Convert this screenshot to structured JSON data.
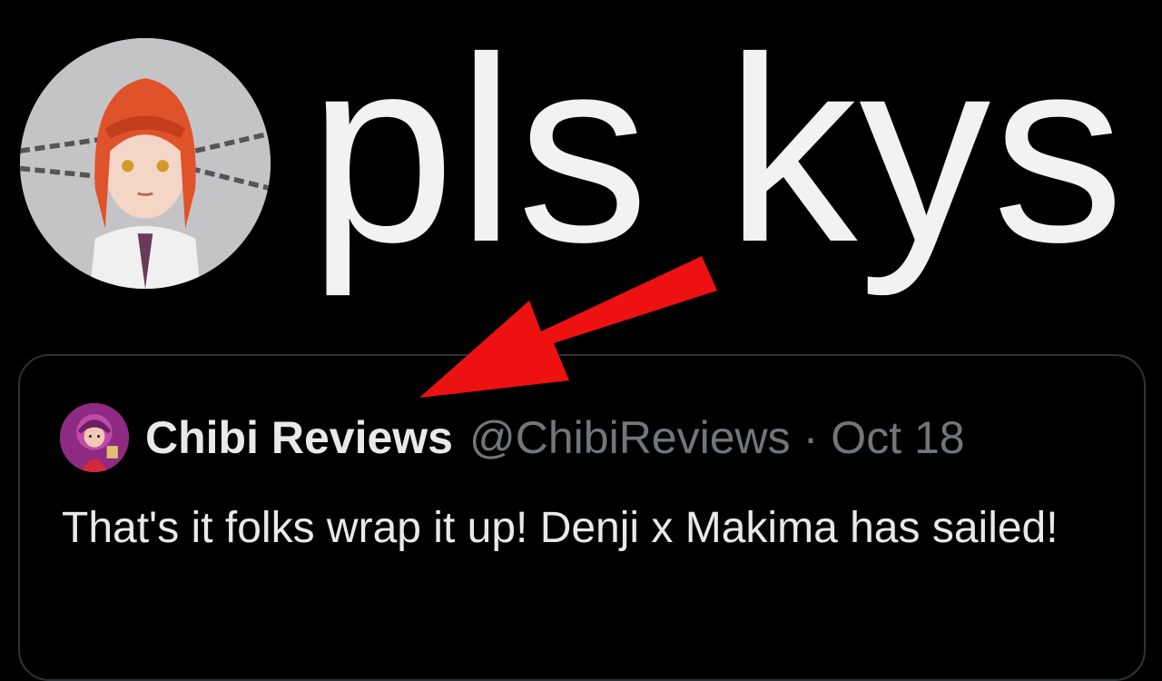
{
  "reply": {
    "text": "pls kys",
    "avatar_icon": "red-haired-character-avatar"
  },
  "quoted_tweet": {
    "display_name": "Chibi Reviews",
    "handle": "@ChibiReviews",
    "separator": "·",
    "date": "Oct 18",
    "avatar_icon": "chibi-character-avatar",
    "body": "That's it folks wrap it up! Denji x Makima has sailed!"
  },
  "annotation": {
    "arrow_icon": "red-arrow-icon",
    "arrow_color": "#ee1111"
  },
  "colors": {
    "background": "#000000",
    "primary_text": "#e7e9ea",
    "secondary_text": "#71767b",
    "card_border": "#2f3336"
  }
}
